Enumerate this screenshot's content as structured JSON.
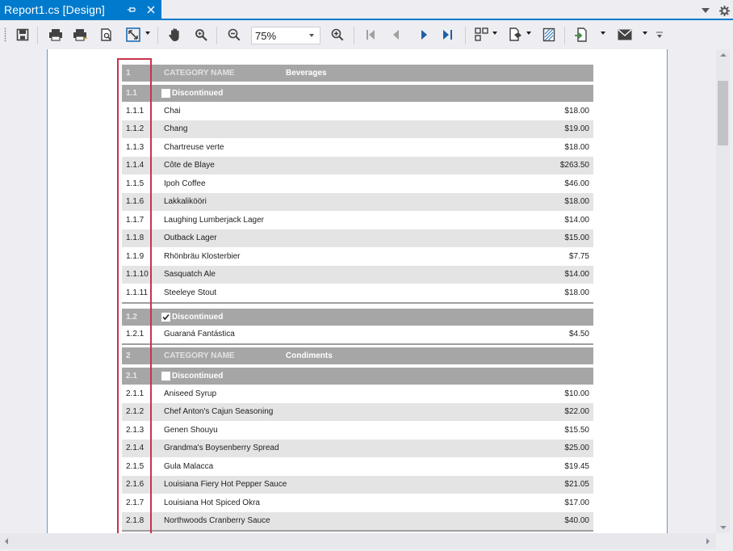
{
  "window": {
    "tab_title": "Report1.cs [Design]",
    "pin_icon": "pin-icon",
    "close_icon": "close-icon",
    "dropdown_icon": "chevron-down-icon",
    "settings_icon": "gear-icon",
    "accent_color": "#007acc"
  },
  "toolbar": {
    "zoom_value": "75%",
    "icons": [
      "save-icon",
      "print-icon",
      "quick-print-icon",
      "print-preview-icon",
      "fit-page-icon",
      "hand-tool-icon",
      "magnifier-icon",
      "zoom-out-icon",
      "zoom-in-icon",
      "first-page-icon",
      "previous-page-icon",
      "next-page-icon",
      "last-page-icon",
      "multiple-pages-icon",
      "page-color-icon",
      "watermark-icon",
      "export-icon",
      "send-email-icon",
      "overflow-icon"
    ]
  },
  "report": {
    "categories": [
      {
        "num": "1",
        "caption": "CATEGORY NAME",
        "name": "Beverages",
        "groups": [
          {
            "num": "1.1",
            "checked": false,
            "label": "Discontinued",
            "items": [
              {
                "num": "1.1.1",
                "name": "Chai",
                "price": "$18.00"
              },
              {
                "num": "1.1.2",
                "name": "Chang",
                "price": "$19.00"
              },
              {
                "num": "1.1.3",
                "name": "Chartreuse verte",
                "price": "$18.00"
              },
              {
                "num": "1.1.4",
                "name": "Côte de Blaye",
                "price": "$263.50"
              },
              {
                "num": "1.1.5",
                "name": "Ipoh Coffee",
                "price": "$46.00"
              },
              {
                "num": "1.1.6",
                "name": "Lakkalikööri",
                "price": "$18.00"
              },
              {
                "num": "1.1.7",
                "name": "Laughing Lumberjack Lager",
                "price": "$14.00"
              },
              {
                "num": "1.1.8",
                "name": "Outback Lager",
                "price": "$15.00"
              },
              {
                "num": "1.1.9",
                "name": "Rhönbräu Klosterbier",
                "price": "$7.75"
              },
              {
                "num": "1.1.10",
                "name": "Sasquatch Ale",
                "price": "$14.00"
              },
              {
                "num": "1.1.11",
                "name": "Steeleye Stout",
                "price": "$18.00"
              }
            ]
          },
          {
            "num": "1.2",
            "checked": true,
            "label": "Discontinued",
            "items": [
              {
                "num": "1.2.1",
                "name": "Guaraná Fantástica",
                "price": "$4.50"
              }
            ]
          }
        ]
      },
      {
        "num": "2",
        "caption": "CATEGORY NAME",
        "name": "Condiments",
        "groups": [
          {
            "num": "2.1",
            "checked": false,
            "label": "Discontinued",
            "items": [
              {
                "num": "2.1.1",
                "name": "Aniseed Syrup",
                "price": "$10.00"
              },
              {
                "num": "2.1.2",
                "name": "Chef Anton's Cajun Seasoning",
                "price": "$22.00"
              },
              {
                "num": "2.1.3",
                "name": "Genen Shouyu",
                "price": "$15.50"
              },
              {
                "num": "2.1.4",
                "name": "Grandma's Boysenberry Spread",
                "price": "$25.00"
              },
              {
                "num": "2.1.5",
                "name": "Gula Malacca",
                "price": "$19.45"
              },
              {
                "num": "2.1.6",
                "name": "Louisiana Fiery Hot Pepper Sauce",
                "price": "$21.05"
              },
              {
                "num": "2.1.7",
                "name": "Louisiana Hot Spiced Okra",
                "price": "$17.00"
              },
              {
                "num": "2.1.8",
                "name": "Northwoods Cranberry Sauce",
                "price": "$40.00"
              }
            ]
          }
        ]
      }
    ]
  }
}
